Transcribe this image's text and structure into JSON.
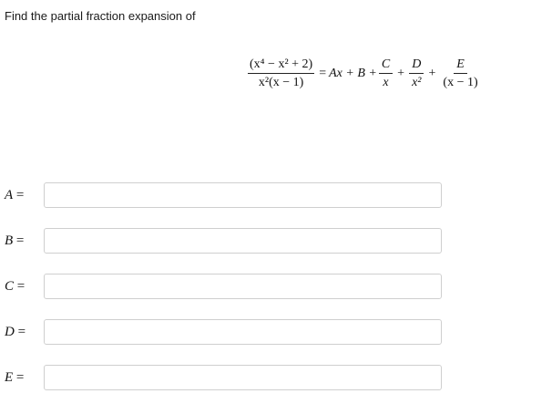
{
  "prompt": "Find the partial fraction expansion of",
  "equation": {
    "lhs_numerator": "(x⁴ − x² + 2)",
    "lhs_denominator": "x²(x − 1)",
    "equals": "=",
    "terms": "Ax + B +",
    "frac_c_num": "C",
    "frac_c_den": "x",
    "plus1": "+",
    "frac_d_num": "D",
    "frac_d_den": "x²",
    "plus2": "+",
    "frac_e_num": "E",
    "frac_e_den": "(x − 1)"
  },
  "answers": [
    {
      "var": "A",
      "eq": "=",
      "value": ""
    },
    {
      "var": "B",
      "eq": "=",
      "value": ""
    },
    {
      "var": "C",
      "eq": "=",
      "value": ""
    },
    {
      "var": "D",
      "eq": "=",
      "value": ""
    },
    {
      "var": "E",
      "eq": "=",
      "value": ""
    }
  ]
}
